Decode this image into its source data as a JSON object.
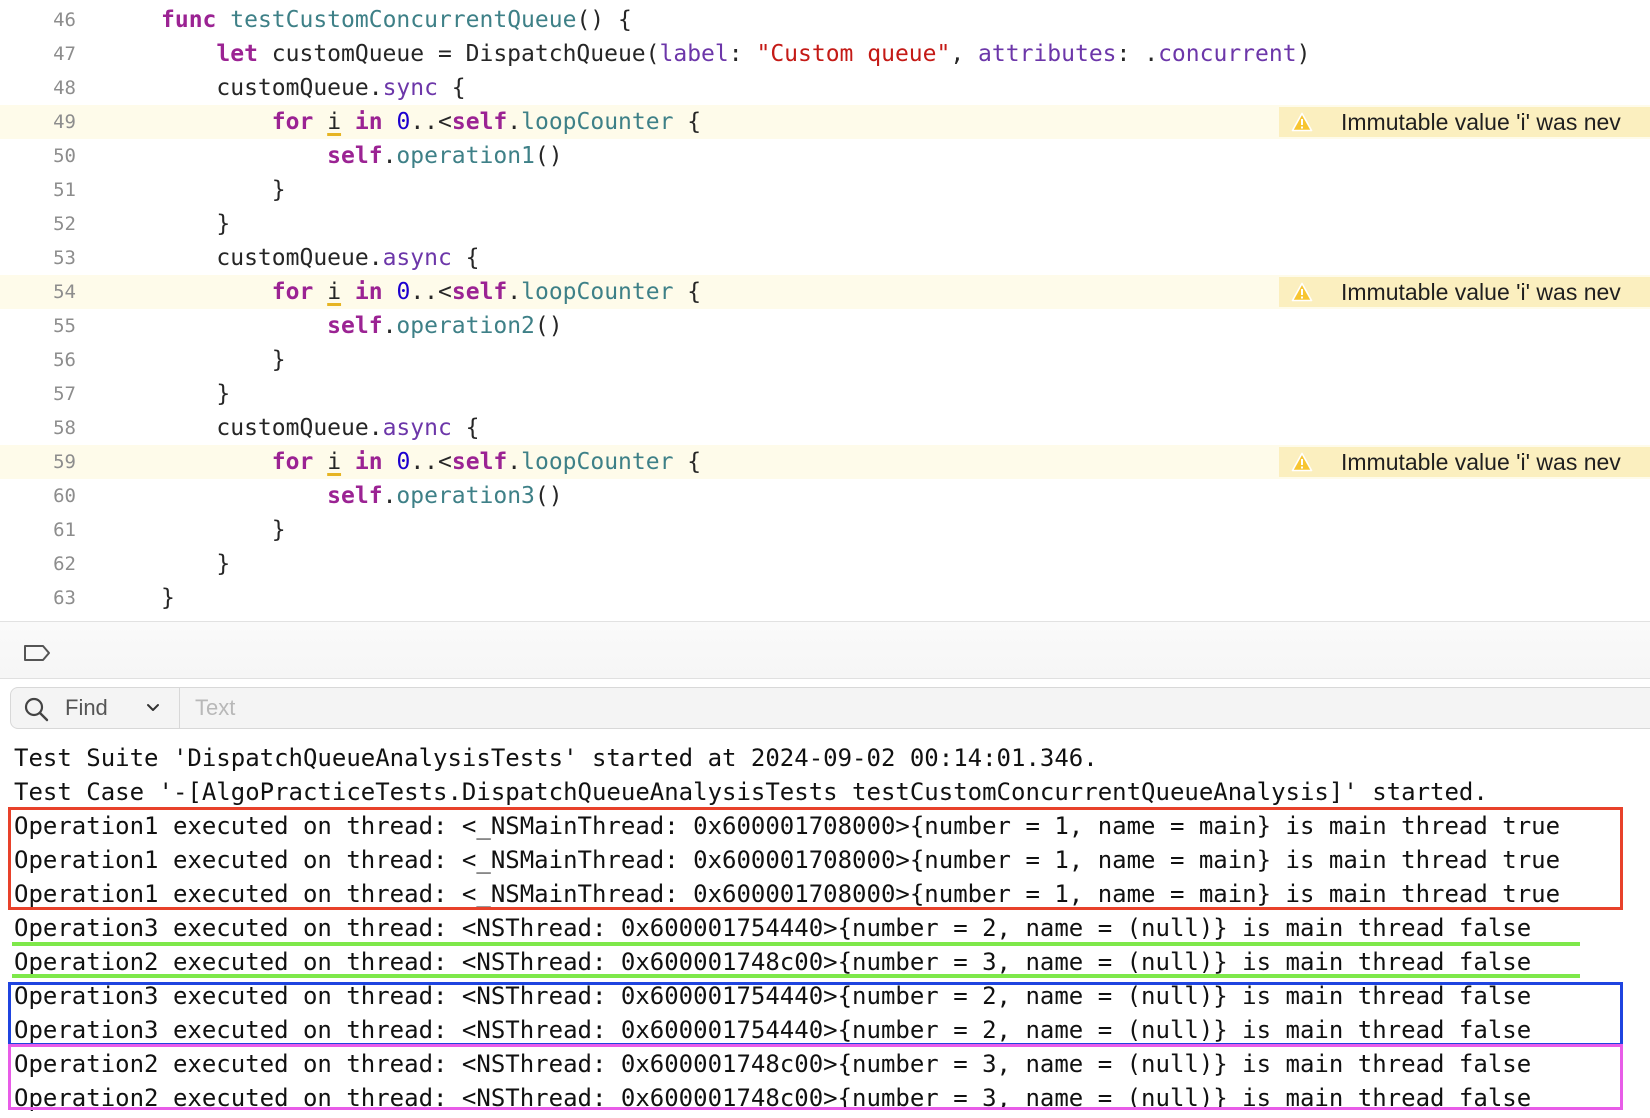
{
  "editor": {
    "lines": [
      {
        "num": "46",
        "warn": false,
        "tokens": [
          {
            "t": "func ",
            "c": "k"
          },
          {
            "t": "testCustomConcurrentQueue",
            "c": "f"
          },
          {
            "t": "() {",
            "c": "p"
          }
        ]
      },
      {
        "num": "47",
        "warn": false,
        "tokens": [
          {
            "t": "    ",
            "c": "p"
          },
          {
            "t": "let",
            "c": "k"
          },
          {
            "t": " customQueue = DispatchQueue(",
            "c": "p"
          },
          {
            "t": "label",
            "c": "m"
          },
          {
            "t": ": ",
            "c": "p"
          },
          {
            "t": "\"Custom queue\"",
            "c": "s"
          },
          {
            "t": ", ",
            "c": "p"
          },
          {
            "t": "attributes",
            "c": "m"
          },
          {
            "t": ": .",
            "c": "p"
          },
          {
            "t": "concurrent",
            "c": "m"
          },
          {
            "t": ")",
            "c": "p"
          }
        ]
      },
      {
        "num": "48",
        "warn": false,
        "tokens": [
          {
            "t": "    customQueue.",
            "c": "p"
          },
          {
            "t": "sync",
            "c": "m"
          },
          {
            "t": " {",
            "c": "p"
          }
        ]
      },
      {
        "num": "49",
        "warn": true,
        "tokens": [
          {
            "t": "        ",
            "c": "p"
          },
          {
            "t": "for",
            "c": "k"
          },
          {
            "t": " ",
            "c": "p"
          },
          {
            "t": "i",
            "c": "u"
          },
          {
            "t": " ",
            "c": "p"
          },
          {
            "t": "in",
            "c": "k"
          },
          {
            "t": " ",
            "c": "p"
          },
          {
            "t": "0",
            "c": "n"
          },
          {
            "t": "..<",
            "c": "p"
          },
          {
            "t": "self",
            "c": "k"
          },
          {
            "t": ".",
            "c": "p"
          },
          {
            "t": "loopCounter",
            "c": "f"
          },
          {
            "t": " {",
            "c": "p"
          }
        ]
      },
      {
        "num": "50",
        "warn": false,
        "tokens": [
          {
            "t": "            ",
            "c": "p"
          },
          {
            "t": "self",
            "c": "k"
          },
          {
            "t": ".",
            "c": "p"
          },
          {
            "t": "operation1",
            "c": "f"
          },
          {
            "t": "()",
            "c": "p"
          }
        ]
      },
      {
        "num": "51",
        "warn": false,
        "tokens": [
          {
            "t": "        }",
            "c": "p"
          }
        ]
      },
      {
        "num": "52",
        "warn": false,
        "tokens": [
          {
            "t": "    }",
            "c": "p"
          }
        ]
      },
      {
        "num": "53",
        "warn": false,
        "tokens": [
          {
            "t": "    customQueue.",
            "c": "p"
          },
          {
            "t": "async",
            "c": "m"
          },
          {
            "t": " {",
            "c": "p"
          }
        ]
      },
      {
        "num": "54",
        "warn": true,
        "tokens": [
          {
            "t": "        ",
            "c": "p"
          },
          {
            "t": "for",
            "c": "k"
          },
          {
            "t": " ",
            "c": "p"
          },
          {
            "t": "i",
            "c": "u"
          },
          {
            "t": " ",
            "c": "p"
          },
          {
            "t": "in",
            "c": "k"
          },
          {
            "t": " ",
            "c": "p"
          },
          {
            "t": "0",
            "c": "n"
          },
          {
            "t": "..<",
            "c": "p"
          },
          {
            "t": "self",
            "c": "k"
          },
          {
            "t": ".",
            "c": "p"
          },
          {
            "t": "loopCounter",
            "c": "f"
          },
          {
            "t": " {",
            "c": "p"
          }
        ]
      },
      {
        "num": "55",
        "warn": false,
        "tokens": [
          {
            "t": "            ",
            "c": "p"
          },
          {
            "t": "self",
            "c": "k"
          },
          {
            "t": ".",
            "c": "p"
          },
          {
            "t": "operation2",
            "c": "f"
          },
          {
            "t": "()",
            "c": "p"
          }
        ]
      },
      {
        "num": "56",
        "warn": false,
        "tokens": [
          {
            "t": "        }",
            "c": "p"
          }
        ]
      },
      {
        "num": "57",
        "warn": false,
        "tokens": [
          {
            "t": "    }",
            "c": "p"
          }
        ]
      },
      {
        "num": "58",
        "warn": false,
        "tokens": [
          {
            "t": "    customQueue.",
            "c": "p"
          },
          {
            "t": "async",
            "c": "m"
          },
          {
            "t": " {",
            "c": "p"
          }
        ]
      },
      {
        "num": "59",
        "warn": true,
        "tokens": [
          {
            "t": "        ",
            "c": "p"
          },
          {
            "t": "for",
            "c": "k"
          },
          {
            "t": " ",
            "c": "p"
          },
          {
            "t": "i",
            "c": "u"
          },
          {
            "t": " ",
            "c": "p"
          },
          {
            "t": "in",
            "c": "k"
          },
          {
            "t": " ",
            "c": "p"
          },
          {
            "t": "0",
            "c": "n"
          },
          {
            "t": "..<",
            "c": "p"
          },
          {
            "t": "self",
            "c": "k"
          },
          {
            "t": ".",
            "c": "p"
          },
          {
            "t": "loopCounter",
            "c": "f"
          },
          {
            "t": " {",
            "c": "p"
          }
        ]
      },
      {
        "num": "60",
        "warn": false,
        "tokens": [
          {
            "t": "            ",
            "c": "p"
          },
          {
            "t": "self",
            "c": "k"
          },
          {
            "t": ".",
            "c": "p"
          },
          {
            "t": "operation3",
            "c": "f"
          },
          {
            "t": "()",
            "c": "p"
          }
        ]
      },
      {
        "num": "61",
        "warn": false,
        "tokens": [
          {
            "t": "        }",
            "c": "p"
          }
        ]
      },
      {
        "num": "62",
        "warn": false,
        "tokens": [
          {
            "t": "    }",
            "c": "p"
          }
        ]
      },
      {
        "num": "63",
        "warn": false,
        "tokens": [
          {
            "t": "}",
            "c": "p"
          }
        ]
      }
    ],
    "warning_text": "Immutable value 'i' was nev",
    "colors": {
      "keyword": "#9b2393",
      "function": "#3e8087",
      "member": "#6c36a9",
      "string": "#c41a16",
      "number": "#1c00cf",
      "warning_bg": "#fbefbf",
      "warning_line_bg": "#fefbea"
    },
    "icons": {
      "warning": "warning-triangle-icon",
      "panel": "tag-icon"
    }
  },
  "findbar": {
    "find_label": "Find",
    "placeholder": "Text",
    "icons": {
      "search": "search-icon",
      "dropdown": "chevron-down-icon"
    }
  },
  "console": {
    "lines": [
      "Test Suite 'DispatchQueueAnalysisTests' started at 2024-09-02 00:14:01.346.",
      "Test Case '-[AlgoPracticeTests.DispatchQueueAnalysisTests testCustomConcurrentQueueAnalysis]' started.",
      "Operation1 executed on thread: <_NSMainThread: 0x600001708000>{number = 1, name = main} is main thread true",
      "Operation1 executed on thread: <_NSMainThread: 0x600001708000>{number = 1, name = main} is main thread true",
      "Operation1 executed on thread: <_NSMainThread: 0x600001708000>{number = 1, name = main} is main thread true",
      "Operation3 executed on thread: <NSThread: 0x600001754440>{number = 2, name = (null)} is main thread false",
      "Operation2 executed on thread: <NSThread: 0x600001748c00>{number = 3, name = (null)} is main thread false",
      "Operation3 executed on thread: <NSThread: 0x600001754440>{number = 2, name = (null)} is main thread false",
      "Operation3 executed on thread: <NSThread: 0x600001754440>{number = 2, name = (null)} is main thread false",
      "Operation2 executed on thread: <NSThread: 0x600001748c00>{number = 3, name = (null)} is main thread false",
      "Operation2 executed on thread: <NSThread: 0x600001748c00>{number = 3, name = (null)} is main thread false"
    ],
    "highlight_colors": {
      "red": "#e8412a",
      "green": "#7ee84a",
      "blue": "#1f44e0",
      "magenta": "#e85ce8"
    }
  }
}
